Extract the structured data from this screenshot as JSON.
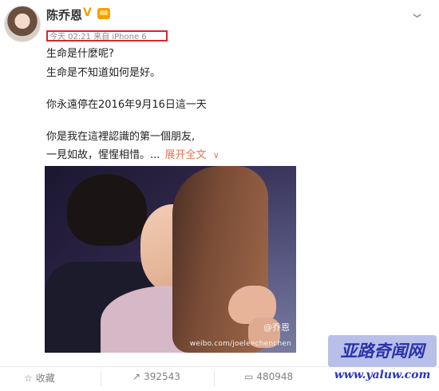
{
  "profile": {
    "username": "陈乔恩",
    "verified_badge": "V",
    "member_icon": "crown-icon",
    "timestamp_source": "今天 02:21 来自 iPhone 6"
  },
  "post": {
    "lines": [
      "生命是什麼呢?",
      "生命是不知道如何是好。",
      "你永遠停在2016年9月16日這一天",
      "你是我在這裡認識的第一個朋友,",
      "一見如故，惺惺相惜。..."
    ],
    "expand_label": "展开全文",
    "expand_icon": "chevron-down-icon"
  },
  "image": {
    "watermark_at": "@乔恩",
    "watermark_url": "weibo.com/joeleechenchen"
  },
  "toolbar": {
    "favorite_label": "收藏",
    "repost_count": "392543",
    "comment_count": "480948"
  },
  "overlay": {
    "site_name": "亚路奇闻网",
    "site_url": "www.yaluw.com"
  },
  "colors": {
    "highlight_box": "#d9262b",
    "link": "#eb7350",
    "verified": "#f4a000"
  }
}
